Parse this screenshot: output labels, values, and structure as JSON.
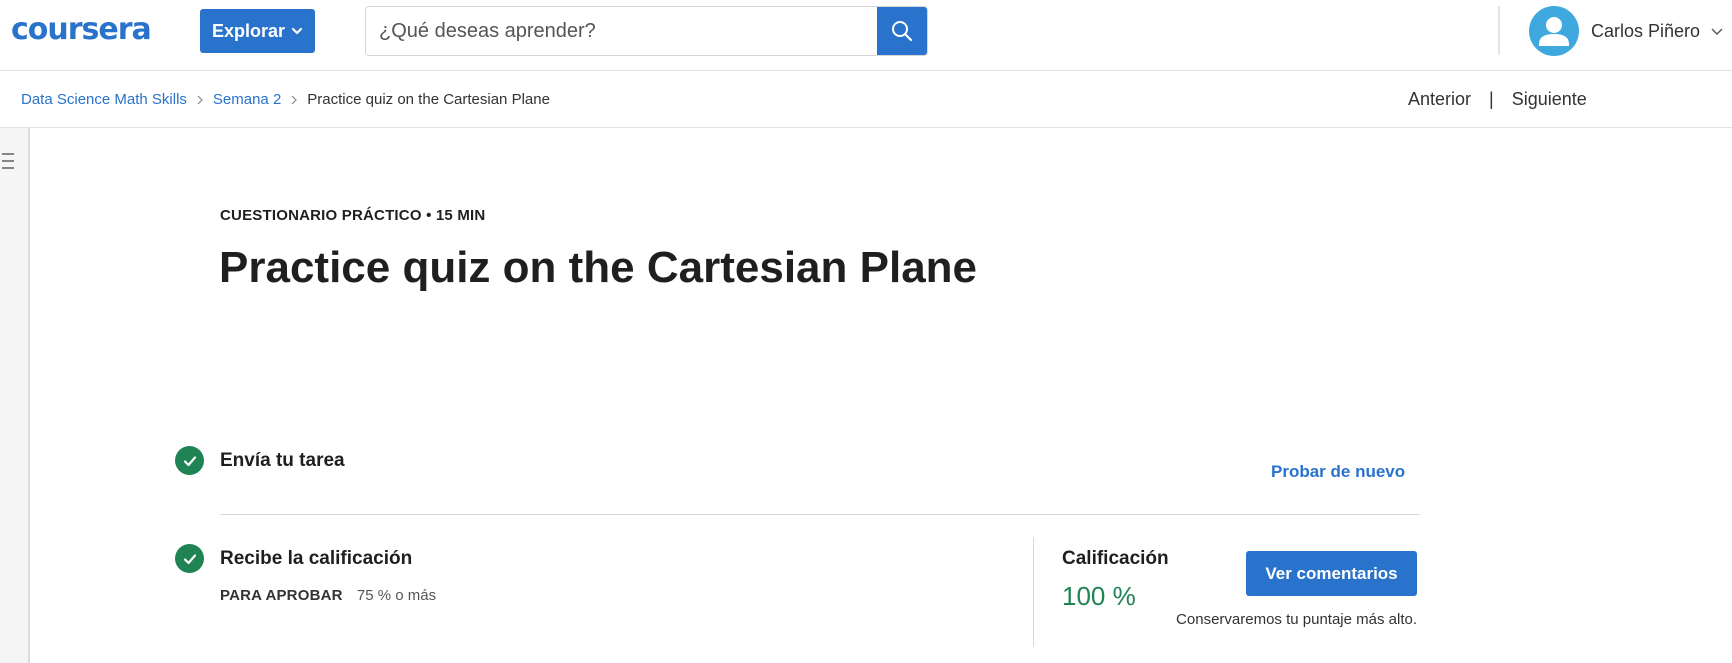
{
  "header": {
    "logo_text": "coursera",
    "explore_label": "Explorar",
    "search": {
      "placeholder": "¿Qué deseas aprender?",
      "value": ""
    },
    "user": {
      "name": "Carlos Piñero"
    }
  },
  "breadcrumb": {
    "items": [
      "Data Science Math Skills",
      "Semana 2",
      "Practice quiz on the Cartesian Plane"
    ]
  },
  "pager": {
    "previous": "Anterior",
    "separator": "|",
    "next": "Siguiente"
  },
  "quiz": {
    "meta": "CUESTIONARIO PRÁCTICO • 15 MIN",
    "title": "Practice quiz on the Cartesian Plane",
    "steps": {
      "submit": {
        "title": "Envía tu tarea",
        "action": "Probar de nuevo"
      },
      "grade": {
        "title": "Recibe la calificación",
        "pass_label": "PARA APROBAR",
        "pass_value": "75 % o más",
        "grade_label": "Calificación",
        "grade_value": "100 %",
        "feedback_button": "Ver comentarios",
        "keep_note": "Conservaremos tu puntaje más alto."
      }
    }
  },
  "colors": {
    "brand": "#2a73cc",
    "success": "#1f8354",
    "avatar": "#3fa8de"
  },
  "icons": {
    "search": "search-icon",
    "explore_chevron": "chevron-down-icon",
    "user_chevron": "chevron-down-icon",
    "breadcrumb_separator": "chevron-right-icon",
    "menu": "menu-icon",
    "check": "check-circle-icon",
    "avatar": "user-icon"
  }
}
